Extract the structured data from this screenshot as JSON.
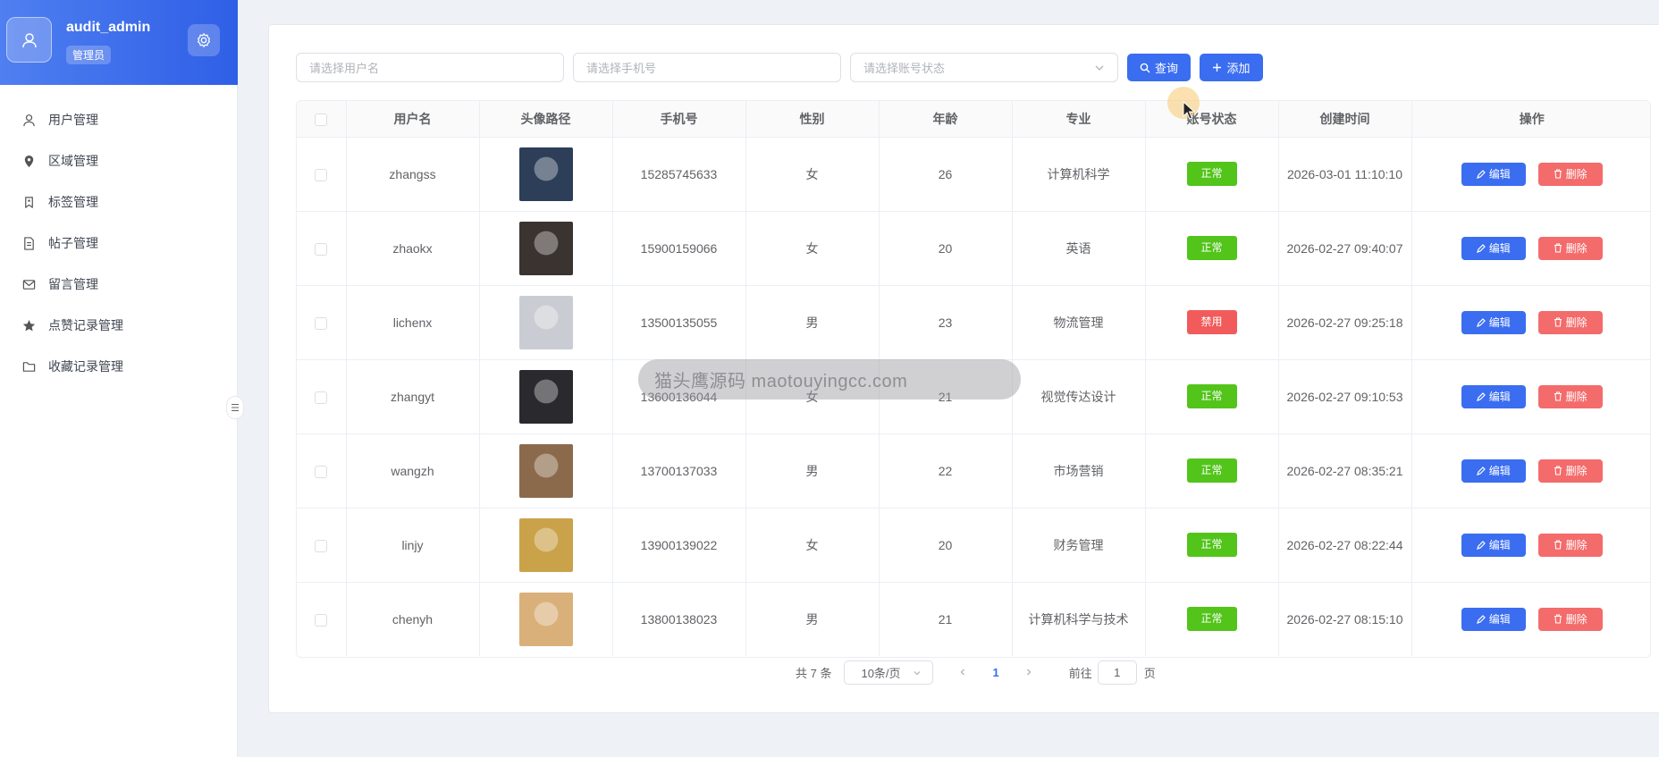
{
  "user": {
    "name": "audit_admin",
    "role": "管理员"
  },
  "sidebar": {
    "items": [
      {
        "label": "用户管理",
        "icon": "user-icon"
      },
      {
        "label": "区域管理",
        "icon": "location-icon"
      },
      {
        "label": "标签管理",
        "icon": "tag-icon"
      },
      {
        "label": "帖子管理",
        "icon": "document-icon"
      },
      {
        "label": "留言管理",
        "icon": "mail-icon"
      },
      {
        "label": "点赞记录管理",
        "icon": "star-icon"
      },
      {
        "label": "收藏记录管理",
        "icon": "folder-icon"
      }
    ]
  },
  "filters": {
    "username_placeholder": "请选择用户名",
    "phone_placeholder": "请选择手机号",
    "status_placeholder": "请选择账号状态",
    "query_label": "查询",
    "add_label": "添加"
  },
  "table": {
    "headers": [
      "用户名",
      "头像路径",
      "手机号",
      "性别",
      "年龄",
      "专业",
      "账号状态",
      "创建时间",
      "操作"
    ],
    "edit_label": "编辑",
    "delete_label": "删除",
    "rows": [
      {
        "username": "zhangss",
        "phone": "15285745633",
        "gender": "女",
        "age": "26",
        "major": "计算机科学",
        "status": "正常",
        "created": "2026-03-01 11:10:10",
        "avatar_color": "#2c3e58"
      },
      {
        "username": "zhaokx",
        "phone": "15900159066",
        "gender": "女",
        "age": "20",
        "major": "英语",
        "status": "正常",
        "created": "2026-02-27 09:40:07",
        "avatar_color": "#3a3330"
      },
      {
        "username": "lichenx",
        "phone": "13500135055",
        "gender": "男",
        "age": "23",
        "major": "物流管理",
        "status": "禁用",
        "created": "2026-02-27 09:25:18",
        "avatar_color": "#c9ccd3"
      },
      {
        "username": "zhangyt",
        "phone": "13600136044",
        "gender": "女",
        "age": "21",
        "major": "视觉传达设计",
        "status": "正常",
        "created": "2026-02-27 09:10:53",
        "avatar_color": "#2a2a2e"
      },
      {
        "username": "wangzh",
        "phone": "13700137033",
        "gender": "男",
        "age": "22",
        "major": "市场营销",
        "status": "正常",
        "created": "2026-02-27 08:35:21",
        "avatar_color": "#8b6a4c"
      },
      {
        "username": "linjy",
        "phone": "13900139022",
        "gender": "女",
        "age": "20",
        "major": "财务管理",
        "status": "正常",
        "created": "2026-02-27 08:22:44",
        "avatar_color": "#c9a24a"
      },
      {
        "username": "chenyh",
        "phone": "13800138023",
        "gender": "男",
        "age": "21",
        "major": "计算机科学与技术",
        "status": "正常",
        "created": "2026-02-27 08:15:10",
        "avatar_color": "#d9b07a"
      }
    ]
  },
  "pagination": {
    "total": "共 7 条",
    "page_size": "10条/页",
    "current_page": "1",
    "goto_label": "前往",
    "goto_value": "1",
    "page_unit": "页"
  },
  "watermark": "猫头鹰源码 maotouyingcc.com",
  "colors": {
    "primary": "#3a6df0",
    "success": "#52c41a",
    "danger": "#f25b5b",
    "header_gradient_start": "#4f7ff0",
    "header_gradient_end": "#2f5fe6"
  }
}
